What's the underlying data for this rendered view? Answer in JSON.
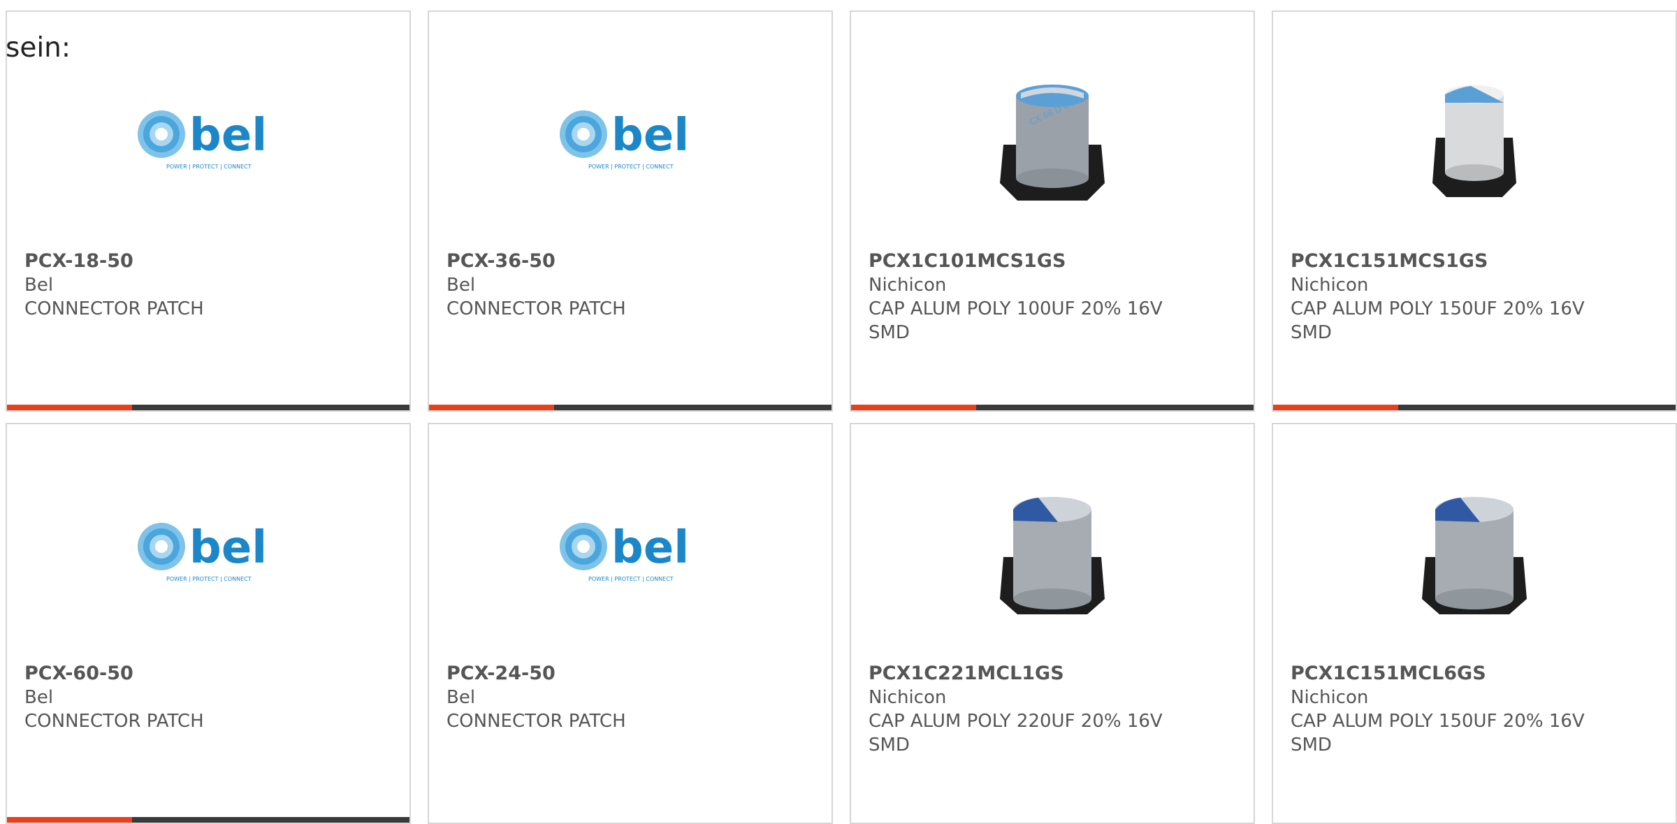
{
  "intro_text": "sein:",
  "colors": {
    "accent": "#e8401c",
    "bar": "#3a3a3a",
    "bel_blue": "#1b87c8",
    "cap_blue": "#2f5aa3",
    "cap_light_blue": "#5aa0d6"
  },
  "products": [
    {
      "part_number": "PCX-18-50",
      "manufacturer": "Bel",
      "description": "CONNECTOR PATCH",
      "image": "bel-logo",
      "logo_text": "bel",
      "logo_tagline": "POWER | PROTECT | CONNECT",
      "progress": 0.31
    },
    {
      "part_number": "PCX-36-50",
      "manufacturer": "Bel",
      "description": "CONNECTOR PATCH",
      "image": "bel-logo",
      "logo_text": "bel",
      "logo_tagline": "POWER | PROTECT | CONNECT",
      "progress": 0.31
    },
    {
      "part_number": "PCX1C101MCS1GS",
      "manufacturer": "Nichicon",
      "description": "CAP ALUM POLY 100UF 20% 16V SMD",
      "image": "capacitor-photo",
      "cap_marking": "CX 68 D 642",
      "progress": 0.31
    },
    {
      "part_number": "PCX1C151MCS1GS",
      "manufacturer": "Nichicon",
      "description": "CAP ALUM POLY 150UF 20% 16V SMD",
      "image": "capacitor-photo",
      "progress": 0.31
    },
    {
      "part_number": "PCX-60-50",
      "manufacturer": "Bel",
      "description": "CONNECTOR PATCH",
      "image": "bel-logo",
      "logo_text": "bel",
      "logo_tagline": "POWER | PROTECT | CONNECT",
      "progress": 0.31
    },
    {
      "part_number": "PCX-24-50",
      "manufacturer": "Bel",
      "description": "CONNECTOR PATCH",
      "image": "bel-logo",
      "logo_text": "bel",
      "logo_tagline": "POWER | PROTECT | CONNECT",
      "progress": 0.31
    },
    {
      "part_number": "PCX1C221MCL1GS",
      "manufacturer": "Nichicon",
      "description": "CAP ALUM POLY 220UF 20% 16V SMD",
      "image": "capacitor-photo",
      "progress": 0.31
    },
    {
      "part_number": "PCX1C151MCL6GS",
      "manufacturer": "Nichicon",
      "description": "CAP ALUM POLY 150UF 20% 16V SMD",
      "image": "capacitor-photo",
      "progress": 0.31
    }
  ]
}
